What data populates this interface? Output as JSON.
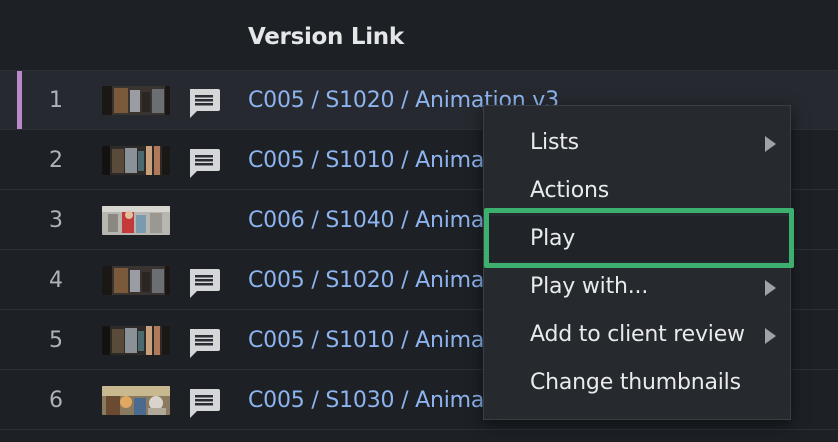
{
  "header": {
    "column_title": "Version Link"
  },
  "rows": [
    {
      "number": "1",
      "link": "C005 / S1020 / Animation v3",
      "has_note": true,
      "thumb": "a"
    },
    {
      "number": "2",
      "link": "C005 / S1010 / Anima",
      "has_note": true,
      "thumb": "b"
    },
    {
      "number": "3",
      "link": "C006 / S1040 / Anima",
      "has_note": false,
      "thumb": "c"
    },
    {
      "number": "4",
      "link": "C005 / S1020 / Anima",
      "has_note": true,
      "thumb": "a"
    },
    {
      "number": "5",
      "link": "C005 / S1010 / Anima",
      "has_note": true,
      "thumb": "b"
    },
    {
      "number": "6",
      "link": "C005 / S1030 / Anima",
      "has_note": true,
      "thumb": "d"
    }
  ],
  "context_menu": {
    "items": [
      {
        "label": "Lists",
        "submenu": true
      },
      {
        "label": "Actions",
        "submenu": false
      },
      {
        "label": "Play",
        "submenu": false
      },
      {
        "label": "Play with...",
        "submenu": true
      },
      {
        "label": "Add to client review",
        "submenu": true
      },
      {
        "label": "Change thumbnails",
        "submenu": false
      }
    ],
    "highlighted_item": "Play"
  },
  "colors": {
    "background": "#1d2126",
    "link": "#8db4ef",
    "selected_accent": "#b98ac7",
    "highlight": "#3db070"
  }
}
